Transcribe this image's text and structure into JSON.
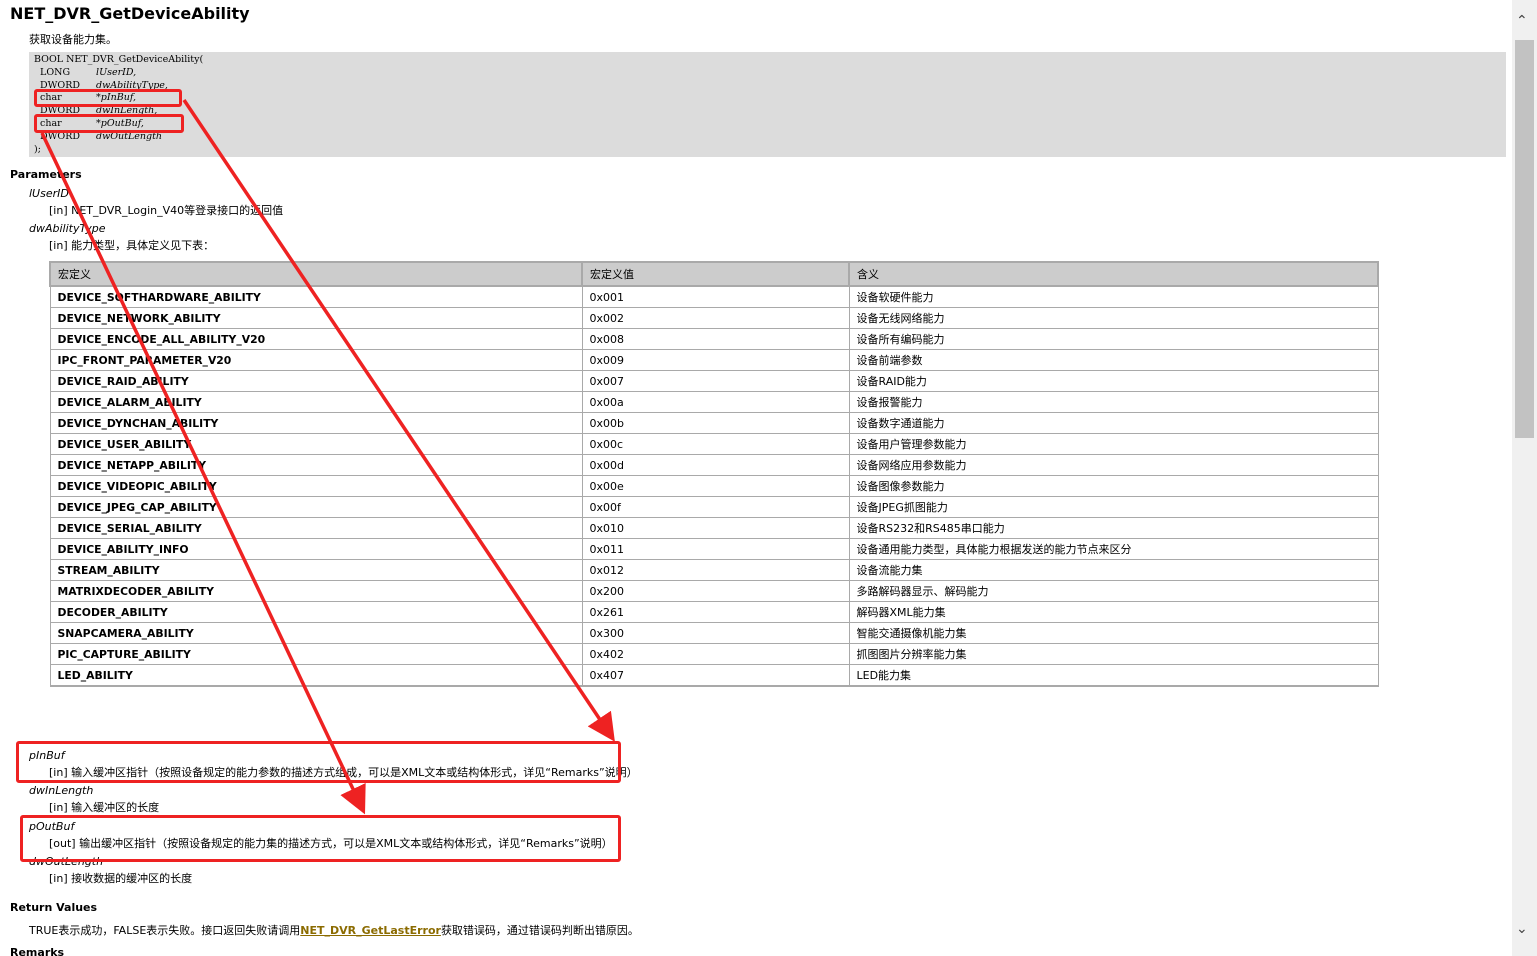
{
  "page": {
    "title": "NET_DVR_GetDeviceAbility",
    "description": "获取设备能力集。"
  },
  "code": {
    "signature": "BOOL NET_DVR_GetDeviceAbility(",
    "params": [
      {
        "type": "LONG",
        "name": "lUserID,"
      },
      {
        "type": "DWORD",
        "name": "dwAbilityType,"
      },
      {
        "type": "char",
        "name": "*pInBuf,"
      },
      {
        "type": "DWORD",
        "name": "dwInLength,"
      },
      {
        "type": "char",
        "name": "*pOutBuf,"
      },
      {
        "type": "DWORD",
        "name": "dwOutLength"
      }
    ],
    "closing": ");"
  },
  "sections": {
    "parameters": "Parameters",
    "return_values": "Return Values",
    "remarks": "Remarks"
  },
  "parameters": {
    "lUserID": {
      "name": "lUserID",
      "desc": "[in] NET_DVR_Login_V40等登录接口的返回值"
    },
    "dwAbilityType": {
      "name": "dwAbilityType",
      "desc": "[in] 能力类型，具体定义见下表："
    },
    "pInBuf": {
      "name": "pInBuf",
      "desc": "[in] 输入缓冲区指针（按照设备规定的能力参数的描述方式组成，可以是XML文本或结构体形式，详见“Remarks”说明）"
    },
    "dwInLength": {
      "name": "dwInLength",
      "desc": "[in] 输入缓冲区的长度"
    },
    "pOutBuf": {
      "name": "pOutBuf",
      "desc": "[out] 输出缓冲区指针（按照设备规定的能力集的描述方式，可以是XML文本或结构体形式，详见“Remarks”说明）"
    },
    "dwOutLength": {
      "name": "dwOutLength",
      "desc": "[in] 接收数据的缓冲区的长度"
    }
  },
  "table": {
    "headers": [
      "宏定义",
      "宏定义值",
      "含义"
    ],
    "rows": [
      [
        "DEVICE_SOFTHARDWARE_ABILITY",
        "0x001",
        "设备软硬件能力"
      ],
      [
        "DEVICE_NETWORK_ABILITY",
        "0x002",
        "设备无线网络能力"
      ],
      [
        "DEVICE_ENCODE_ALL_ABILITY_V20",
        "0x008",
        "设备所有编码能力"
      ],
      [
        "IPC_FRONT_PARAMETER_V20",
        "0x009",
        "设备前端参数"
      ],
      [
        "DEVICE_RAID_ABILITY",
        "0x007",
        "设备RAID能力"
      ],
      [
        "DEVICE_ALARM_ABILITY",
        "0x00a",
        "设备报警能力"
      ],
      [
        "DEVICE_DYNCHAN_ABILITY",
        "0x00b",
        "设备数字通道能力"
      ],
      [
        "DEVICE_USER_ABILITY",
        "0x00c",
        "设备用户管理参数能力"
      ],
      [
        "DEVICE_NETAPP_ABILITY",
        "0x00d",
        "设备网络应用参数能力"
      ],
      [
        "DEVICE_VIDEOPIC_ABILITY",
        "0x00e",
        "设备图像参数能力"
      ],
      [
        "DEVICE_JPEG_CAP_ABILITY",
        "0x00f",
        "设备JPEG抓图能力"
      ],
      [
        "DEVICE_SERIAL_ABILITY",
        "0x010",
        "设备RS232和RS485串口能力"
      ],
      [
        "DEVICE_ABILITY_INFO",
        "0x011",
        "设备通用能力类型，具体能力根据发送的能力节点来区分"
      ],
      [
        "STREAM_ABILITY",
        "0x012",
        "设备流能力集"
      ],
      [
        "MATRIXDECODER_ABILITY",
        "0x200",
        "多路解码器显示、解码能力"
      ],
      [
        "DECODER_ABILITY",
        "0x261",
        "解码器XML能力集"
      ],
      [
        "SNAPCAMERA_ABILITY",
        "0x300",
        "智能交通摄像机能力集"
      ],
      [
        "PIC_CAPTURE_ABILITY",
        "0x402",
        "抓图图片分辨率能力集"
      ],
      [
        "LED_ABILITY",
        "0x407",
        "LED能力集"
      ]
    ]
  },
  "return": {
    "text_before": "TRUE表示成功，FALSE表示失败。接口返回失败请调用",
    "link": "NET_DVR_GetLastError",
    "text_after": "获取错误码，通过错误码判断出错原因。"
  },
  "colors": {
    "annotation": "#ee2222",
    "code_bg": "#dcdcdc",
    "table_header_bg": "#cccccc",
    "link": "#8b6b00"
  }
}
